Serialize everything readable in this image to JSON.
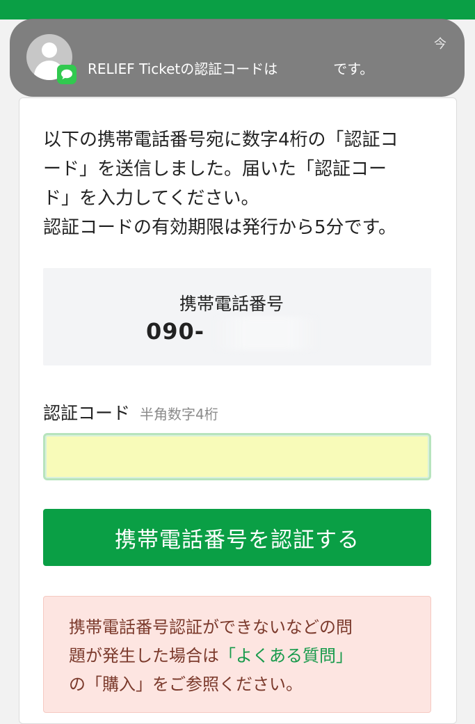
{
  "notification": {
    "text": "RELIEF Ticketの認証コードは　　　　です。",
    "time": "今",
    "icon": "messages-icon"
  },
  "intro": {
    "lines": [
      "以下の携帯電話番号宛に数字4桁の「認証コ",
      "ード」を送信しました。届いた「認証コー",
      "ド」を入力してください。",
      "認証コードの有効期限は発行から5分です。"
    ]
  },
  "phone": {
    "label": "携帯電話番号",
    "number_prefix": "090-"
  },
  "code": {
    "label": "認証コード",
    "hint": "半角数字4桁",
    "value": ""
  },
  "verify_button": {
    "label": "携帯電話番号を認証する"
  },
  "notice": {
    "text_1": "携帯電話番号認証ができないなどの問",
    "text_2": "題が発生した場合は",
    "link": "「よくある質問」",
    "text_3": "の「購入」をご参照ください。"
  },
  "colors": {
    "brand_green": "#0a9f45",
    "input_bg": "#f8fbb9",
    "notice_bg": "#fde5e1"
  }
}
